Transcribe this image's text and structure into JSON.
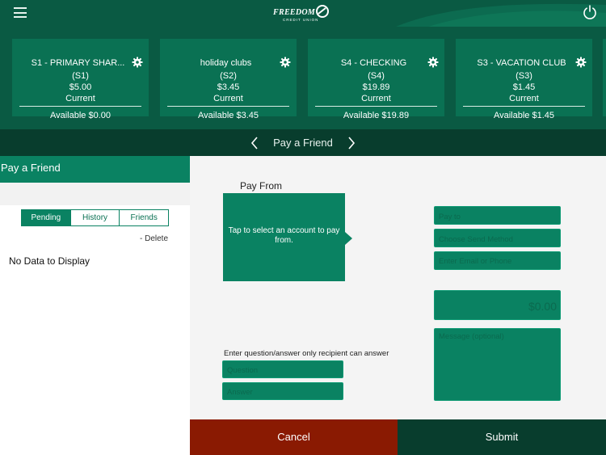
{
  "header": {
    "logo_text": "FREEDOM",
    "logo_subtext": "CREDIT UNION",
    "menu_icon": "hamburger-icon",
    "power_icon": "power-icon"
  },
  "accounts": [
    {
      "name": "S1 - PRIMARY SHAR...",
      "code": "(S1)",
      "balance": "$5.00",
      "status": "Current",
      "available": "Available $0.00"
    },
    {
      "name": "holiday clubs",
      "code": "(S2)",
      "balance": "$3.45",
      "status": "Current",
      "available": "Available $3.45"
    },
    {
      "name": "S4 - CHECKING",
      "code": "(S4)",
      "balance": "$19.89",
      "status": "Current",
      "available": "Available $19.89"
    },
    {
      "name": "S3 - VACATION CLUB",
      "code": "(S3)",
      "balance": "$1.45",
      "status": "Current",
      "available": "Available $1.45"
    }
  ],
  "nav": {
    "title": "Pay a Friend"
  },
  "left_panel": {
    "title": "Pay a Friend",
    "tabs": [
      "Pending",
      "History",
      "Friends"
    ],
    "delete_label": "- Delete",
    "empty_text": "No Data to Display"
  },
  "form": {
    "pay_from_label": "Pay From",
    "pay_from_prompt": "Tap to select an account to pay from.",
    "pay_to_placeholder": "Pay to",
    "send_method_placeholder": "Choose Send Method",
    "contact_placeholder": "Enter Email or Phone",
    "amount_placeholder": "$0.00",
    "message_placeholder": "Message (optional)",
    "qa_label": "Enter question/answer only recipient can answer",
    "question_placeholder": "Question",
    "answer_placeholder": "Answer"
  },
  "buttons": {
    "cancel": "Cancel",
    "submit": "Submit"
  },
  "colors": {
    "primary": "#0a8262",
    "dark": "#083d2d",
    "cancel": "#8a1a02"
  }
}
